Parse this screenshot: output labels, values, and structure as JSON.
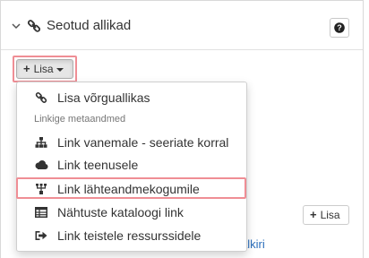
{
  "panel": {
    "title": "Seotud allikad",
    "chevron_icon": "chevron-down-icon",
    "title_icon": "link-icon",
    "help_icon": "question-circle-icon"
  },
  "add_button": {
    "label": "Lisa",
    "icon": "plus-icon",
    "caret": "caret-down-icon"
  },
  "add_button_secondary": {
    "label": "Lisa",
    "icon": "plus-icon"
  },
  "background_link": {
    "text": "alkiri"
  },
  "dropdown": {
    "items": [
      {
        "label": "Lisa võrguallikas",
        "icon": "link-icon"
      }
    ],
    "section_header": "Linkige metaandmed",
    "metadata_items": [
      {
        "label": "Link vanemale - seeriate korral",
        "icon": "sitemap-icon"
      },
      {
        "label": "Link teenusele",
        "icon": "cloud-icon"
      },
      {
        "label": "Link lähteandmekogumile",
        "icon": "source-dataset-icon",
        "highlighted": true
      },
      {
        "label": "Nähtuste kataloogi link",
        "icon": "table-icon"
      },
      {
        "label": "Link teistele ressurssidele",
        "icon": "sign-out-icon"
      }
    ]
  },
  "colors": {
    "highlight_border": "#ef8e95",
    "link": "#2a6ebb",
    "text": "#333333"
  }
}
